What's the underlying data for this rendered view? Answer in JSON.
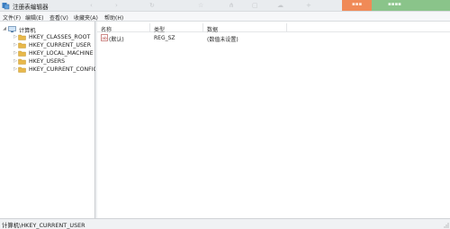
{
  "window": {
    "title": "注册表编辑器",
    "icon": "regedit-icon"
  },
  "menu": {
    "items": [
      "文件(F)",
      "编辑(E)",
      "查看(V)",
      "收藏夹(A)",
      "帮助(H)"
    ]
  },
  "tree": {
    "root_label": "计算机",
    "root_icon": "computer-icon",
    "hives": [
      "HKEY_CLASSES_ROOT",
      "HKEY_CURRENT_USER",
      "HKEY_LOCAL_MACHINE",
      "HKEY_USERS",
      "HKEY_CURRENT_CONFIG"
    ],
    "expander_glyph": "▷"
  },
  "list": {
    "columns": [
      "名称",
      "类型",
      "数据"
    ],
    "rows": [
      {
        "name": "(默认)",
        "type": "REG_SZ",
        "data": "(数值未设置)",
        "icon": "string-value-icon"
      }
    ]
  },
  "status": {
    "path": "计算机\\HKEY_CURRENT_USER"
  },
  "colors": {
    "folder": "#e8b84a",
    "orange_tab": "#f08a57",
    "green_tab": "#8ac48a"
  }
}
